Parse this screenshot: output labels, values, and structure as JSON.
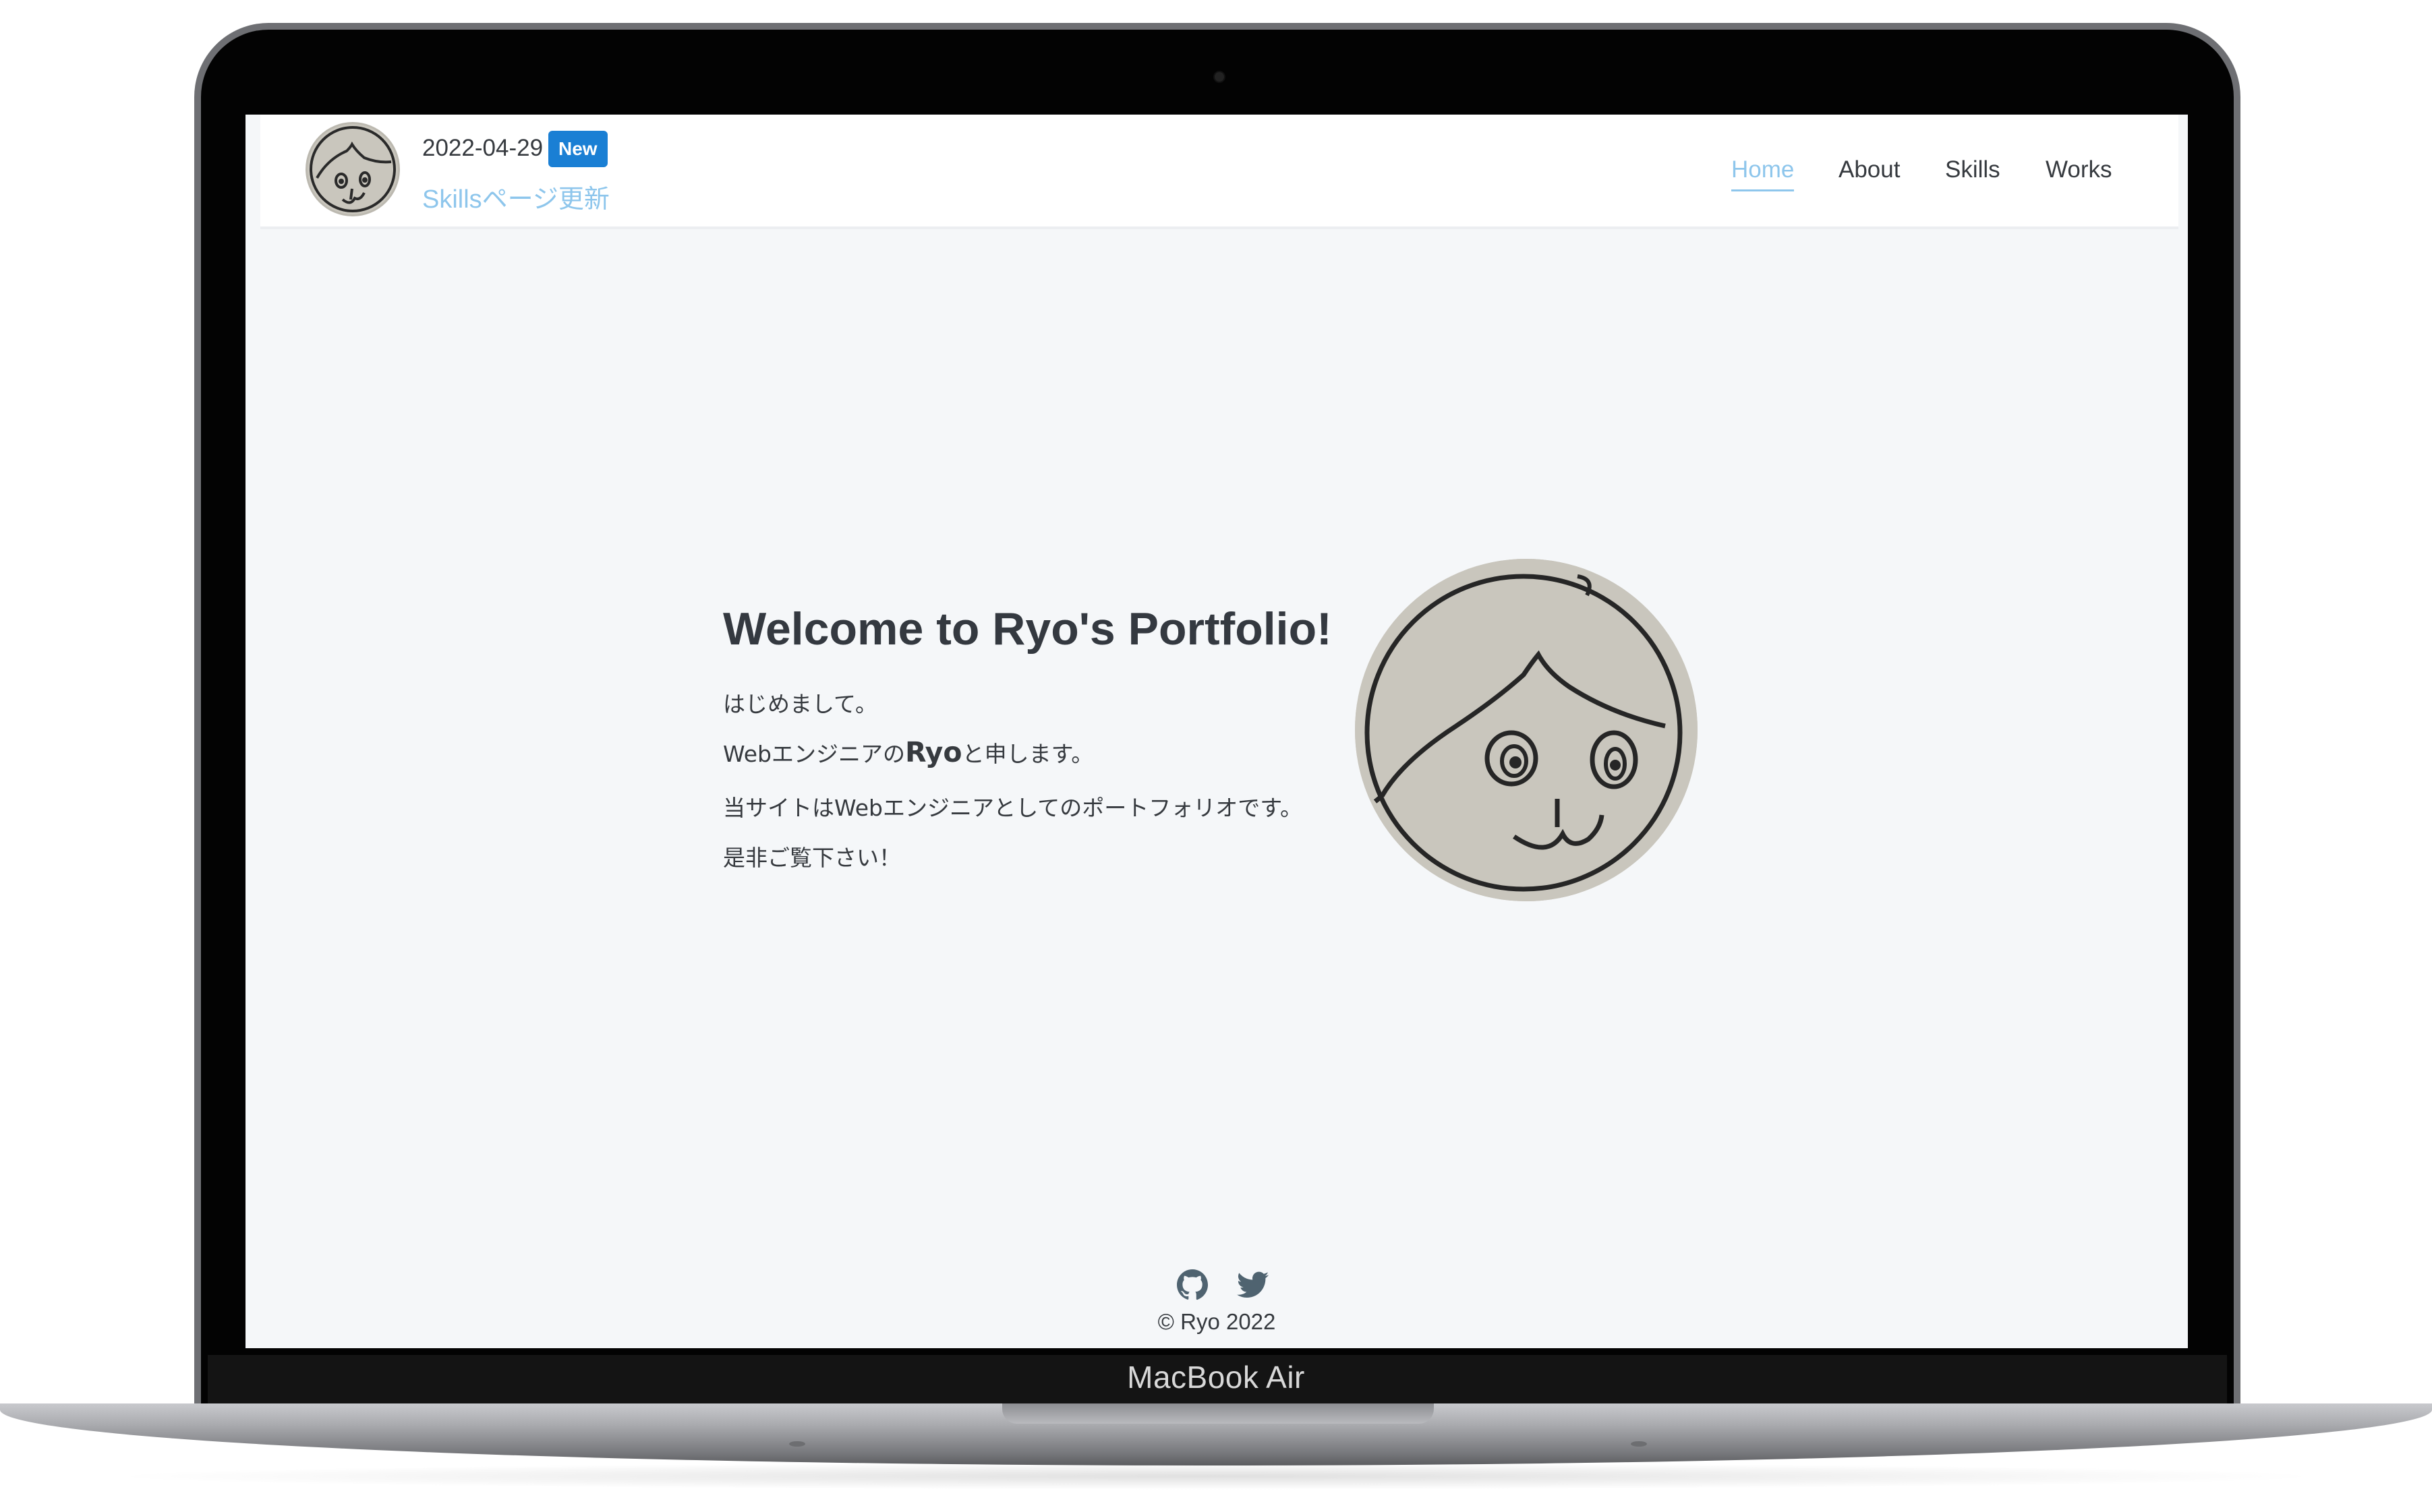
{
  "device": {
    "label": "MacBook Air"
  },
  "header": {
    "avatar_icon": "ryo-face-avatar-icon",
    "news": {
      "date": "2022-04-29",
      "badge": "New",
      "link_text": "Skillsページ更新"
    },
    "nav": [
      {
        "label": "Home",
        "active": true
      },
      {
        "label": "About",
        "active": false
      },
      {
        "label": "Skills",
        "active": false
      },
      {
        "label": "Works",
        "active": false
      }
    ]
  },
  "hero": {
    "title": "Welcome to Ryo's Portfolio!",
    "line1": "はじめまして。",
    "line2_pre": "Webエンジニアの",
    "line2_name": "Ryo",
    "line2_post": "と申します。",
    "line3": "当サイトはWebエンジニアとしてのポートフォリオです。",
    "line4": "是非ご覧下さい！",
    "image_icon": "ryo-face-illustration"
  },
  "footer": {
    "icons": [
      "github-icon",
      "twitter-icon"
    ],
    "copyright": "© Ryo 2022"
  },
  "colors": {
    "accent": "#8ec6ec",
    "badge": "#1a7fd4",
    "text": "#363a3f",
    "page_bg": "#f5f7f9",
    "icon": "#4f6370"
  }
}
